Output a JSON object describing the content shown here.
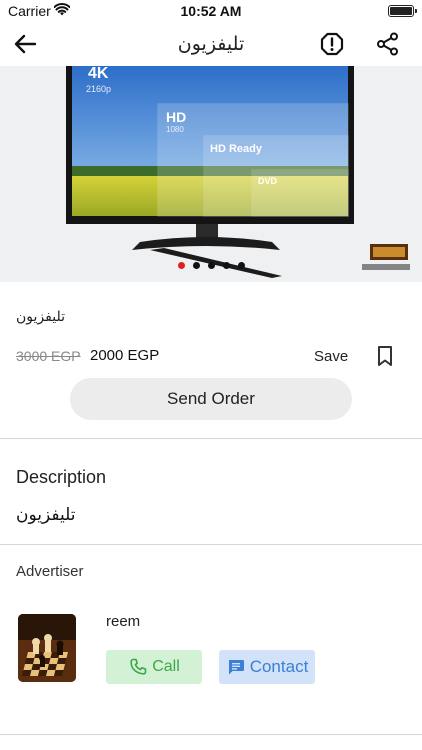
{
  "status_bar": {
    "carrier": "Carrier",
    "time": "10:52 AM",
    "wifi_icon": "wifi-icon",
    "battery_icon": "battery-icon"
  },
  "nav": {
    "title": "تليفزيون",
    "back_icon": "arrow-left-icon",
    "report_icon": "alert-octagon-icon",
    "share_icon": "share-icon"
  },
  "gallery": {
    "image": "tv-product-photo",
    "image_count": 5,
    "active_index": 0,
    "active_dot_color": "#e02020",
    "inactive_dot_color": "#111111",
    "image_labels": [
      "4K",
      "2160p",
      "HD",
      "1080",
      "HD Ready",
      "DVD"
    ]
  },
  "product": {
    "name": "تليفزيون",
    "old_price": "3000 EGP",
    "price": "2000 EGP",
    "save_label": "Save",
    "bookmark_icon": "bookmark-icon",
    "send_order_label": "Send Order"
  },
  "description": {
    "heading": "Description",
    "text": "تليفزيون"
  },
  "advertiser": {
    "heading": "Advertiser",
    "name": "reem",
    "avatar": "chess-board-avatar",
    "call_label": "Call",
    "call_icon": "phone-icon",
    "call_color": "#3aa845",
    "contact_label": "Contact",
    "contact_icon": "message-icon",
    "contact_color": "#3b7fd6"
  }
}
